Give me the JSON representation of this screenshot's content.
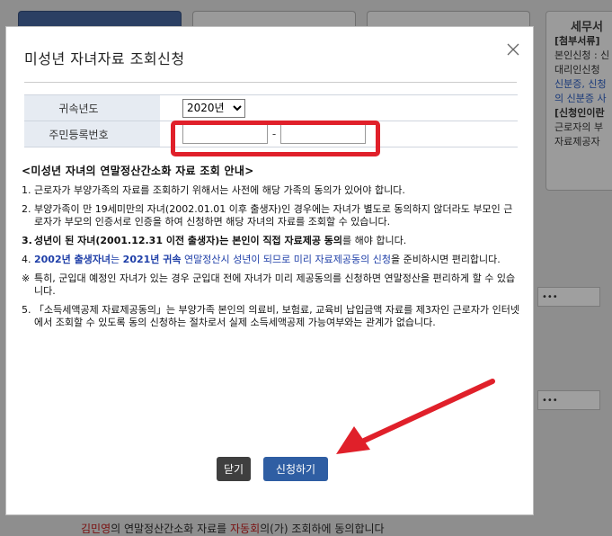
{
  "background": {
    "side_panel": {
      "title": "세무서",
      "lines": [
        "[첨부서류]",
        "본인신청 : 신",
        "대리인신청",
        "신분증, 신청",
        "의 신분증 사",
        "[신청인이란",
        "근로자의 부",
        "자료제공자"
      ]
    },
    "field_mask": "•••",
    "bottom_text": {
      "name": "김민영",
      "text_a": "의 연말정산간소화 자료를 ",
      "highlight": "자동회",
      "text_b": "의(가) 조회하에 동의합니다"
    }
  },
  "modal": {
    "title": "미성년 자녀자료 조회신청",
    "form": {
      "year_label": "귀속년도",
      "year_selected": "2020년",
      "year_options": [
        "2020년"
      ],
      "rrn_label": "주민등록번호",
      "rrn_front": "",
      "rrn_back": "",
      "rrn_separator": "-"
    },
    "notice": {
      "title": "<미성년 자녀의 연말정산간소화 자료 조회 안내>",
      "item1_num": "1.",
      "item1": "근로자가 부양가족의 자료를 조회하기 위해서는 사전에 해당 가족의 동의가 있어야 합니다.",
      "item2_num": "2.",
      "item2": "부양가족이 만 19세미만의 자녀(2002.01.01 이후 출생자)인 경우에는 자녀가 별도로 동의하지 않더라도 부모인 근로자가 부모의 인증서로 인증을 하여 신청하면 해당 자녀의 자료를 조회할 수 있습니다.",
      "item3_num": "3.",
      "item3_bold": "성년이 된 자녀(2001.12.31 이전 출생자)는 본인이 직접 자료제공 동의",
      "item3_rest": "를 해야 합니다.",
      "item4_num": "4.",
      "item4_a": "2002년 출생자녀",
      "item4_b": "는 ",
      "item4_c": "2021년 귀속",
      "item4_d": " 연말정산시 성년이 되므로 미리 자료제공동의 신청",
      "item4_e": "을 준비하시면 편리합니다.",
      "note_mark": "※",
      "note": "특히, 군입대 예정인 자녀가 있는 경우 군입대 전에 자녀가 미리 제공동의를 신청하면 연말정산을 편리하게 할 수 있습니다.",
      "item5_num": "5.",
      "item5": "「소득세액공제 자료제공동의」는 부양가족 본인의 의료비, 보험료, 교육비 납입금액 자료를 제3자인 근로자가 인터넷에서 조회할 수 있도록 동의 신청하는 절차로서 실제 소득세액공제 가능여부와는 관계가 없습니다."
    },
    "buttons": {
      "close_label": "닫기",
      "apply_label": "신청하기"
    }
  },
  "colors": {
    "highlight_box": "#e0202a",
    "arrow": "#e0202a",
    "apply_button": "#2f5ea3",
    "close_button": "#3f3f3f",
    "label_cell": "#e6ebf2"
  }
}
